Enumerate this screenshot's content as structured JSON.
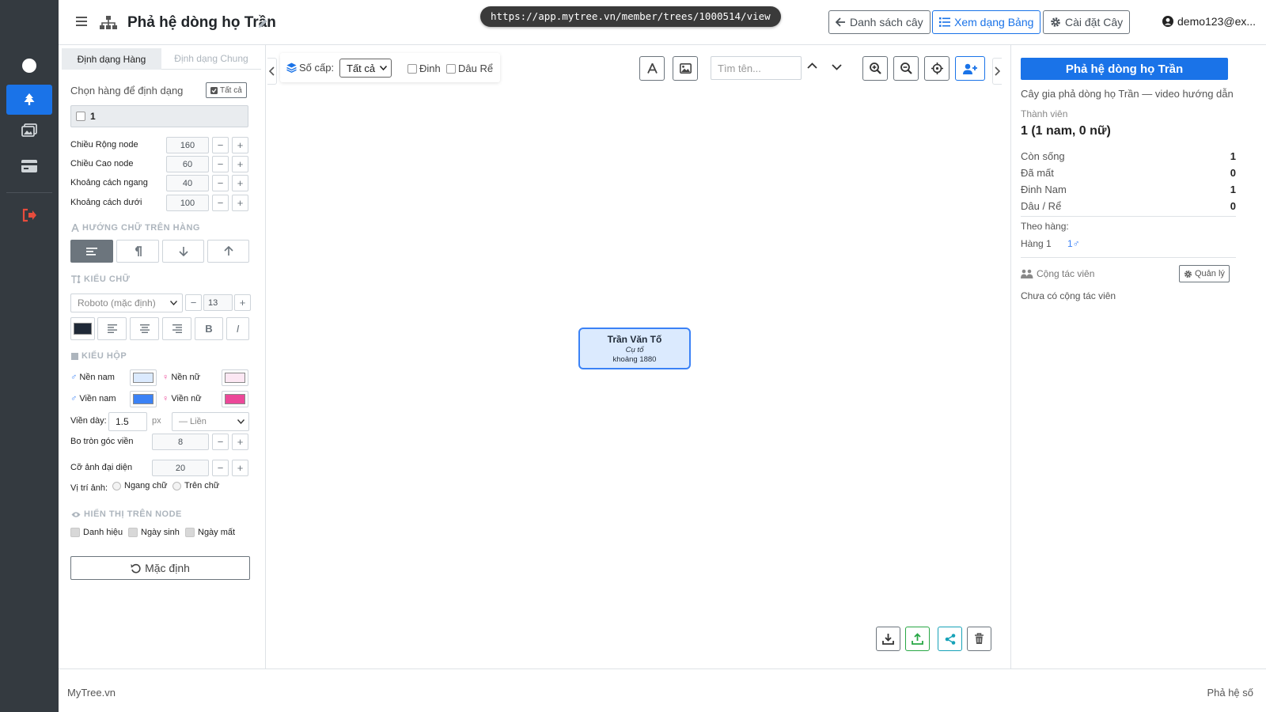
{
  "header": {
    "title": "Phả hệ dòng họ Trần",
    "url": "https://app.mytree.vn/member/trees/1000514/view",
    "btn_list": "Danh sách cây",
    "btn_table": "Xem dạng Bảng",
    "btn_settings": "Cài đặt Cây",
    "user": "demo123@ex..."
  },
  "left_panel": {
    "tab_row": "Định dạng Hàng",
    "tab_general": "Định dạng Chung",
    "choose_rows": "Chọn hàng để định dạng",
    "select_all": "Tất cả",
    "row_option": "1",
    "fields": [
      {
        "label": "Chiều Rộng node",
        "value": "160"
      },
      {
        "label": "Chiều Cao node",
        "value": "60"
      },
      {
        "label": "Khoảng cách ngang",
        "value": "40"
      },
      {
        "label": "Khoảng cách dưới",
        "value": "100"
      }
    ],
    "sec_direction": "HƯỚNG CHỮ TRÊN HÀNG",
    "sec_font": "KIỂU CHỮ",
    "font_name": "Roboto (mặc định)",
    "font_size": "13",
    "sec_box": "KIỂU HỘP",
    "male_bg": "Nền nam",
    "female_bg": "Nền nữ",
    "male_border": "Viền nam",
    "female_border": "Viền nữ",
    "colors": {
      "male_bg": "#dbeafe",
      "female_bg": "#fce7f3",
      "male_border": "#3b82f6",
      "female_border": "#ec4899",
      "text": "#1f2937"
    },
    "border_width_label": "Viền dày:",
    "border_width": "1.5",
    "unit_px": "px",
    "border_style": "— Liền",
    "radius_label": "Bo tròn góc viền",
    "radius": "8",
    "avatar_label": "Cỡ ảnh đại diện",
    "avatar": "20",
    "img_pos_label": "Vị trí ảnh:",
    "img_pos_horizontal": "Ngang chữ",
    "img_pos_top": "Trên chữ",
    "sec_display": "HIỂN THỊ TRÊN NODE",
    "show_title": "Danh hiệu",
    "show_birth": "Ngày sinh",
    "show_death": "Ngày mất",
    "reset": "Mặc định"
  },
  "canvas": {
    "levels_label": "Số cấp:",
    "levels_value": "Tất cả",
    "cb_dinh": "Đinh",
    "cb_daure": "Dâu Rể",
    "search_placeholder": "Tìm tên...",
    "node": {
      "name": "Trần Văn Tố",
      "title": "Cụ tổ",
      "date": "khoảng 1880"
    }
  },
  "right_panel": {
    "title_btn": "Phả hệ dòng họ Trần",
    "description": "Cây gia phả dòng họ Trần — video hướng dẫn",
    "members_label": "Thành viên",
    "members_value": "1 (1 nam, 0 nữ)",
    "stats": [
      {
        "label": "Còn sống",
        "value": "1"
      },
      {
        "label": "Đã mất",
        "value": "0"
      },
      {
        "label": "Đinh Nam",
        "value": "1"
      },
      {
        "label": "Dâu / Rể",
        "value": "0"
      }
    ],
    "by_row_label": "Theo hàng:",
    "row1_label": "Hàng 1",
    "row1_value": "1♂",
    "collab_label": "Cộng tác viên",
    "manage": "Quản lý",
    "no_collab": "Chưa có cộng tác viên"
  },
  "footer": {
    "left": "MyTree.vn",
    "right": "Phả hệ số"
  }
}
